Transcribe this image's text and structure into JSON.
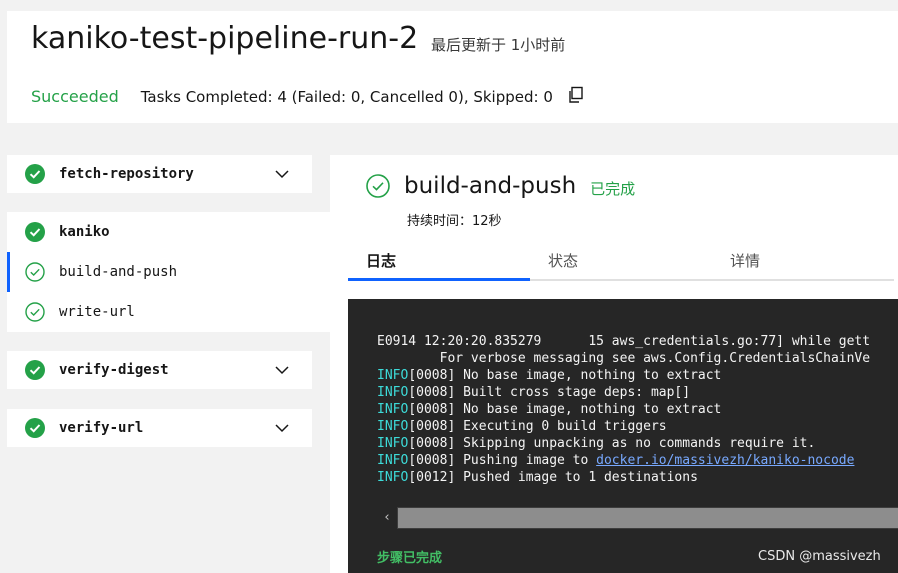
{
  "header": {
    "run_title": "kaniko-test-pipeline-run-2",
    "updated": "最后更新于 1小时前",
    "status": "Succeeded",
    "tasks_summary": "Tasks Completed: 4 (Failed: 0, Cancelled 0), Skipped: 0"
  },
  "tasks": {
    "fetch_repository": "fetch-repository",
    "kaniko": "kaniko",
    "kaniko_steps": [
      "build-and-push",
      "write-url"
    ],
    "verify_digest": "verify-digest",
    "verify_url": "verify-url"
  },
  "detail": {
    "step_title": "build-and-push",
    "step_status": "已完成",
    "duration": "持续时间：12秒",
    "tabs": [
      "日志",
      "状态",
      "详情"
    ],
    "log_lines": [
      "E0914 12:20:20.835279      15 aws_credentials.go:77] while gett",
      "        For verbose messaging see aws.Config.CredentialsChainVe",
      "[0008] No base image, nothing to extract",
      "[0008] Built cross stage deps: map[]",
      "[0008] No base image, nothing to extract",
      "[0008] Executing 0 build triggers",
      "[0008] Skipping unpacking as no commands require it.",
      "[0008] Pushing image to ",
      "[0012] Pushed image to 1 destinations"
    ],
    "info_prefix": "INFO",
    "push_link": "docker.io/massivezh/kaniko-nocode",
    "step_complete": "步骤已完成"
  },
  "watermark": "CSDN @massivezh",
  "colors": {
    "success": "#24a148",
    "accent": "#0f62fe",
    "log_bg": "#262626",
    "info": "#3ddbd9",
    "link": "#78a9ff"
  }
}
